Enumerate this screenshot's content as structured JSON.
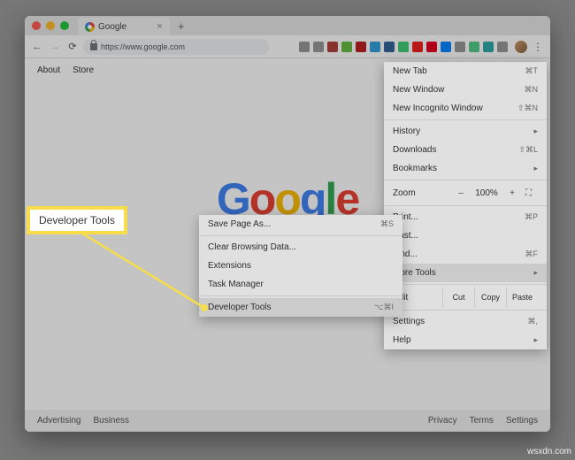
{
  "tab": {
    "title": "Google"
  },
  "address_bar": {
    "url": "https://www.google.com"
  },
  "page": {
    "nav_about": "About",
    "nav_store": "Store",
    "footer_advertising": "Advertising",
    "footer_business": "Business",
    "footer_privacy": "Privacy",
    "footer_terms": "Terms",
    "footer_settings": "Settings"
  },
  "main_menu": {
    "new_tab": "New Tab",
    "new_tab_sc": "⌘T",
    "new_window": "New Window",
    "new_window_sc": "⌘N",
    "incognito": "New Incognito Window",
    "incognito_sc": "⇧⌘N",
    "history": "History",
    "downloads": "Downloads",
    "downloads_sc": "⇧⌘L",
    "bookmarks": "Bookmarks",
    "zoom": "Zoom",
    "zoom_minus": "–",
    "zoom_val": "100%",
    "zoom_plus": "+",
    "print": "Print...",
    "print_sc": "⌘P",
    "cast": "Cast...",
    "find": "Find...",
    "find_sc": "⌘F",
    "more_tools": "More Tools",
    "edit": "Edit",
    "cut": "Cut",
    "copy": "Copy",
    "paste": "Paste",
    "settings": "Settings",
    "settings_sc": "⌘,",
    "help": "Help"
  },
  "submenu": {
    "save_page": "Save Page As...",
    "save_page_sc": "⌘S",
    "clear_data": "Clear Browsing Data...",
    "extensions": "Extensions",
    "task_manager": "Task Manager",
    "dev_tools": "Developer Tools",
    "dev_tools_sc": "⌥⌘I"
  },
  "callout": {
    "text": "Developer Tools"
  },
  "watermark": "wsxdn.com",
  "ext_colors": [
    "#999",
    "#999",
    "#b0413e",
    "#6b4",
    "#b22",
    "#34a0db",
    "#369",
    "#4c7",
    "#e22",
    "#e60023",
    "#0a84ff",
    "#999",
    "#5c8",
    "#3aa",
    "#999"
  ]
}
